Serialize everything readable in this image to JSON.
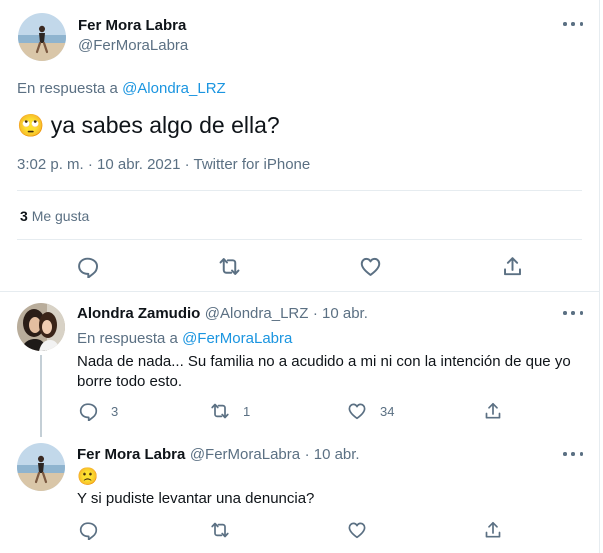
{
  "main_tweet": {
    "author_name": "Fer Mora Labra",
    "author_handle": "@FerMoraLabra",
    "reply_prefix": "En respuesta a",
    "reply_to": "@Alondra_LRZ",
    "emoji": "🙄",
    "text": "ya sabes algo de ella?",
    "meta": "3:02 p. m. · 10 abr. 2021 · Twitter for iPhone",
    "likes_count": "3",
    "likes_label": "Me gusta"
  },
  "replies": [
    {
      "author_name": "Alondra Zamudio",
      "author_handle": "@Alondra_LRZ",
      "date": "· 10 abr.",
      "reply_prefix": "En respuesta a",
      "reply_to": "@FerMoraLabra",
      "text_line1": "Nada de nada... Su familia no a acudido a mi ni con la intención de que yo",
      "text_line2": "borre todo esto.",
      "reply_count": "3",
      "retweet_count": "1",
      "like_count": "34"
    },
    {
      "author_name": "Fer Mora Labra",
      "author_handle": "@FerMoraLabra",
      "date": "· 10 abr.",
      "emoji": "🙁",
      "text": "Y si pudiste levantar una denuncia?",
      "reply_count": "",
      "retweet_count": "",
      "like_count": ""
    }
  ],
  "icons": {
    "reply": "reply-icon",
    "retweet": "retweet-icon",
    "like": "heart-icon",
    "share": "share-icon",
    "more": "more-icon"
  },
  "colors": {
    "link": "#1b95e0",
    "muted": "#5b7083",
    "text": "#0f1419",
    "divider": "#e6ecf0"
  }
}
